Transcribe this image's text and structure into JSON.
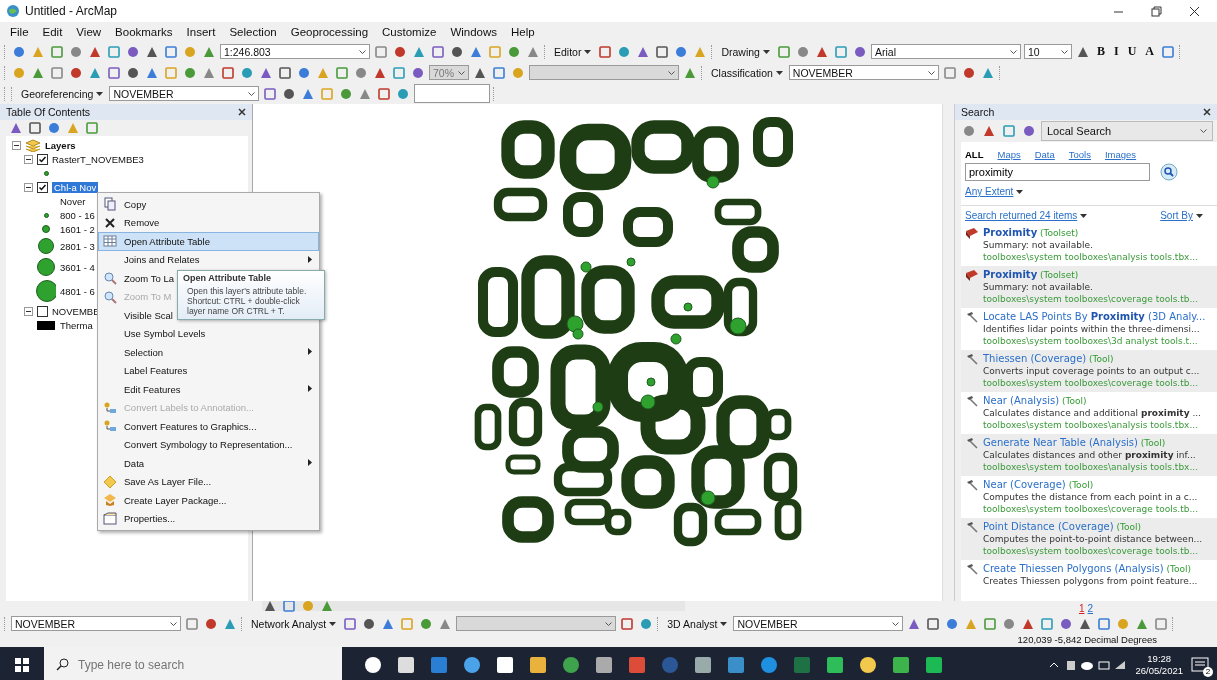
{
  "window": {
    "title": "Untitled - ArcMap"
  },
  "menu_bar": [
    "File",
    "Edit",
    "View",
    "Bookmarks",
    "Insert",
    "Selection",
    "Geoprocessing",
    "Customize",
    "Windows",
    "Help"
  ],
  "toolbars": [
    [
      {
        "kind": "combo",
        "value": "1:246.803"
      },
      {
        "kind": "menu",
        "label": "Editor"
      },
      {
        "kind": "menu",
        "label": "Drawing"
      },
      {
        "kind": "combo",
        "value": "Arial"
      },
      {
        "kind": "combo",
        "value": "10"
      },
      {
        "kind": "glyph",
        "label": "B"
      },
      {
        "kind": "glyph",
        "label": "I"
      },
      {
        "kind": "glyph",
        "label": "U"
      },
      {
        "kind": "glyph",
        "label": "A"
      }
    ],
    [
      {
        "kind": "combo",
        "value": "70%",
        "disabled": true
      },
      {
        "kind": "combo",
        "disabled": true
      },
      {
        "kind": "menu",
        "label": "Classification"
      },
      {
        "kind": "combo",
        "value": "NOVEMBER"
      }
    ],
    [
      {
        "kind": "menu",
        "label": "Georeferencing"
      },
      {
        "kind": "combo",
        "value": "NOVEMBER"
      },
      {
        "kind": "field"
      }
    ]
  ],
  "toc": {
    "title": "Table Of Contents",
    "tree": [
      {
        "label": "Layers",
        "kind": "group",
        "expanded": true,
        "children": [
          {
            "label": "RasterT_NOVEMBE3",
            "kind": "layer",
            "checked": true,
            "expanded": true,
            "selected": false,
            "children": [
              {
                "kind": "symbol"
              }
            ]
          },
          {
            "label": "Chl-a Nov",
            "kind": "layer",
            "checked": true,
            "expanded": true,
            "selected": true,
            "children": [
              {
                "kind": "heading",
                "label": "Nover"
              },
              {
                "kind": "symbol",
                "label": "800 - 16"
              },
              {
                "kind": "symbol",
                "label": "1601 - 2"
              },
              {
                "kind": "symbol",
                "label": "2801 - 3"
              },
              {
                "kind": "symbol",
                "label": "3601 - 4"
              },
              {
                "kind": "symbol",
                "label": "4801 - 6"
              }
            ]
          },
          {
            "label": "NOVEMBE",
            "kind": "layer",
            "checked": false,
            "expanded": true,
            "selected": false,
            "children": [
              {
                "kind": "swatch",
                "label": "Therma"
              }
            ]
          }
        ]
      }
    ]
  },
  "context_menu": {
    "items": [
      {
        "label": "Copy",
        "kind": "copy",
        "selected": false,
        "disabled": false,
        "submenu": false
      },
      {
        "label": "Remove",
        "kind": "remove",
        "selected": false,
        "disabled": false,
        "submenu": false
      },
      {
        "label": "Open Attribute Table",
        "kind": "table",
        "selected": true,
        "disabled": false,
        "submenu": false
      },
      {
        "label": "Joins and Relates",
        "kind": "none",
        "selected": false,
        "disabled": false,
        "submenu": true
      },
      {
        "label": "Zoom To La",
        "kind": "zoom",
        "selected": false,
        "disabled": false
      },
      {
        "label": "Zoom To M",
        "kind": "zoom",
        "selected": false,
        "disabled": true
      },
      {
        "label": "Visible Scal",
        "kind": "none",
        "selected": false,
        "disabled": false
      },
      {
        "label": "Use Symbol Levels",
        "kind": "none",
        "selected": false,
        "disabled": false,
        "submenu": false
      },
      {
        "label": "Selection",
        "kind": "none",
        "selected": false,
        "disabled": false,
        "submenu": true
      },
      {
        "label": "Label Features",
        "kind": "none",
        "selected": false,
        "disabled": false,
        "submenu": false
      },
      {
        "label": "Edit Features",
        "kind": "none",
        "selected": false,
        "disabled": false,
        "submenu": true
      },
      {
        "label": "Convert Labels to Annotation...",
        "kind": "convert",
        "selected": false,
        "disabled": true,
        "submenu": false
      },
      {
        "label": "Convert Features to Graphics...",
        "kind": "convert",
        "selected": false,
        "disabled": false,
        "submenu": false
      },
      {
        "label": "Convert Symbology to Representation...",
        "kind": "none",
        "selected": false,
        "disabled": false,
        "submenu": false
      },
      {
        "label": "Data",
        "kind": "none",
        "selected": false,
        "disabled": false,
        "submenu": true
      },
      {
        "label": "Save As Layer File...",
        "kind": "diamond",
        "selected": false,
        "disabled": false,
        "submenu": false
      },
      {
        "label": "Create Layer Package...",
        "kind": "package",
        "selected": false,
        "disabled": false,
        "submenu": false
      },
      {
        "label": "Properties...",
        "kind": "properties",
        "selected": false,
        "disabled": false,
        "submenu": false
      }
    ]
  },
  "tooltip": {
    "title": "Open Attribute Table",
    "text": "Open this layer's attribute table. Shortcut: CTRL + double-click layer name OR CTRL + T."
  },
  "search": {
    "title": "Search",
    "scope": "Local Search",
    "tabs": [
      {
        "label": "ALL",
        "selected": true
      },
      {
        "label": "Maps",
        "selected": false
      },
      {
        "label": "Data",
        "selected": false
      },
      {
        "label": "Tools",
        "selected": false
      },
      {
        "label": "Images",
        "selected": false
      }
    ],
    "query": "proximity",
    "extent": "Any Extent",
    "summary": "Search returned 24 items",
    "sort": "Sort By",
    "results": [
      {
        "kind": "toolset",
        "title": "**Proximity**",
        "type": "(Toolset)",
        "summary": "Summary: not available.",
        "path": "toolboxes\\system toolboxes\\analysis tools.tbx..."
      },
      {
        "kind": "toolset",
        "title": "**Proximity**",
        "type": "(Toolset)",
        "summary": "Summary: not available.",
        "path": "toolboxes\\system toolboxes\\coverage tools.tb..."
      },
      {
        "kind": "tool",
        "title": "Locate LAS Points By **Proximity** (3D Analy...",
        "summary": "Identifies lidar points within the three-dimensi...",
        "path": "toolboxes\\system toolboxes\\3d analyst tools.t..."
      },
      {
        "kind": "tool",
        "title": "Thiessen (Coverage)",
        "type": "(Tool)",
        "summary": "Converts input coverage points to an output c...",
        "path": "toolboxes\\system toolboxes\\coverage tools.tb..."
      },
      {
        "kind": "tool",
        "title": "Near (Analysis)",
        "type": "(Tool)",
        "summary": "Calculates distance and additional **proximity** ...",
        "path": "toolboxes\\system toolboxes\\analysis tools.tbx..."
      },
      {
        "kind": "tool",
        "title": "Generate Near Table (Analysis)",
        "type": "(Tool)",
        "summary": "Calculates distances and other **proximity** inf...",
        "path": "toolboxes\\system toolboxes\\analysis tools.tbx..."
      },
      {
        "kind": "tool",
        "title": "Near (Coverage)",
        "type": "(Tool)",
        "summary": "Computes the distance from each point in a c...",
        "path": "toolboxes\\system toolboxes\\coverage tools.tb..."
      },
      {
        "kind": "tool",
        "title": "Point Distance (Coverage)",
        "type": "(Tool)",
        "summary": "Computes the point-to-point distance between...",
        "path": "toolboxes\\system toolboxes\\coverage tools.tb..."
      },
      {
        "kind": "tool",
        "title": "Create Thiessen Polygons (Analysis)",
        "type": "(Tool)",
        "summary": "Creates Thiessen polygons from point feature..."
      }
    ],
    "pages": [
      {
        "label": "1",
        "selected": true
      },
      {
        "label": "2",
        "selected": false
      }
    ]
  },
  "bottom_toolbar": [
    {
      "kind": "combo",
      "value": "NOVEMBER"
    },
    {
      "kind": "menu",
      "label": "Network Analyst"
    },
    {
      "kind": "combo",
      "disabled": true
    },
    {
      "kind": "menu",
      "label": "3D Analyst"
    },
    {
      "kind": "combo",
      "value": "NOVEMBER"
    }
  ],
  "status_bar": {
    "coordinates": "120,039  -5,842 Decimal Degrees"
  },
  "taskbar": {
    "search_placeholder": "Type here to search",
    "time": "19:28",
    "date": "26/05/2021",
    "notifications": "2"
  }
}
